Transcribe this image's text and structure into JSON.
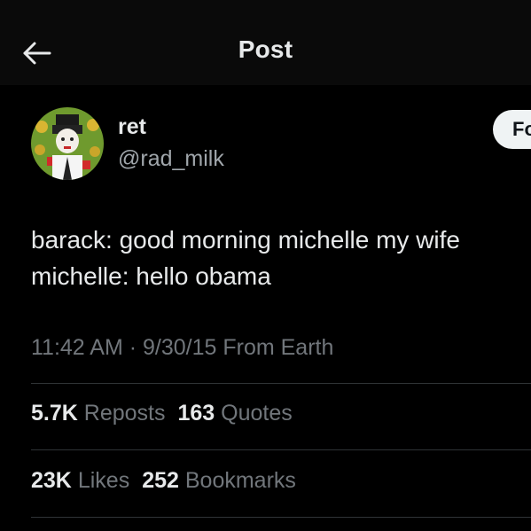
{
  "header": {
    "title": "Post",
    "back_icon": "arrow-left-icon"
  },
  "author": {
    "display_name": "ret",
    "handle": "@rad_milk",
    "follow_label": "Fo"
  },
  "tweet": {
    "lines": [
      "barack: good morning michelle my wife",
      "michelle: hello obama"
    ]
  },
  "meta": {
    "text": "11:42 AM · 9/30/15 From Earth"
  },
  "stats": {
    "reposts": {
      "count": "5.7K",
      "label": "Reposts"
    },
    "quotes": {
      "count": "163",
      "label": "Quotes"
    },
    "likes": {
      "count": "23K",
      "label": "Likes"
    },
    "bookmarks": {
      "count": "252",
      "label": "Bookmarks"
    }
  },
  "colors": {
    "background": "#000000",
    "header_background": "#0a0a0a",
    "primary_text": "#e7e9ea",
    "secondary_text": "#71767b",
    "divider": "#2f3336",
    "follow_button": "#eff3f4"
  }
}
